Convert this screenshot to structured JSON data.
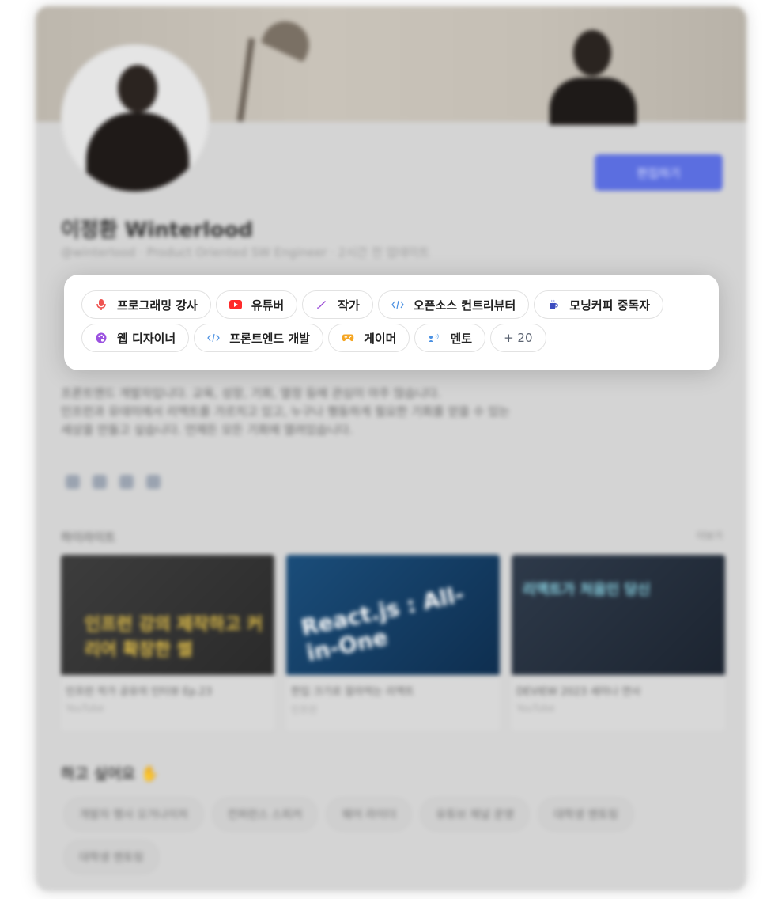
{
  "profile": {
    "name": "이정환 Winterlood",
    "subline": "@winterlood · Product Oriented SW Engineer · 2시간 전 업데이트",
    "edit_button": "편집하기",
    "bio_lines": [
      "프론트엔드 개발자입니다. 교육, 성장, 기회, 열정 등에 관심이 아주 많습니다.",
      "인프런과 유데미에서 리액트를 가르치고 있고, 누구나 행동하게 필요한 기회를 얻을 수 있는",
      "세상을 만들고 싶습니다. 언제든 모든 기회에 열려있습니다."
    ]
  },
  "tags": [
    {
      "label": "프로그래밍 강사",
      "icon": "microphone-icon",
      "color": "#ef5350"
    },
    {
      "label": "유튜버",
      "icon": "youtube-icon",
      "color": "#ff2b2b"
    },
    {
      "label": "작가",
      "icon": "pen-icon",
      "color": "#9c4dd6"
    },
    {
      "label": "오픈소스 컨트리뷰터",
      "icon": "code-icon",
      "color": "#4a90e2"
    },
    {
      "label": "모닝커피 중독자",
      "icon": "coffee-icon",
      "color": "#3b4cc0"
    },
    {
      "label": "웹 디자이너",
      "icon": "palette-icon",
      "color": "#9b51e0"
    },
    {
      "label": "프론트엔드 개발",
      "icon": "code-icon",
      "color": "#4a90e2"
    },
    {
      "label": "게이머",
      "icon": "gamepad-icon",
      "color": "#f5a623"
    },
    {
      "label": "멘토",
      "icon": "mentor-icon",
      "color": "#4a90e2"
    }
  ],
  "more_tag": "+ 20",
  "highlights": {
    "title": "하이라이트",
    "more": "더보기",
    "videos": [
      {
        "title": "인프런 작가 공유의 인터뷰 Ep.23",
        "source": "YouTube",
        "thumb_text": "인프런 강의 제작하고 커리어 확장한 썰"
      },
      {
        "title": "한입 크기로 잘라먹는 리액트",
        "source": "인프런",
        "thumb_text": "React.js : All-in-One"
      },
      {
        "title": "DEVIEW 2023 세미나 연사",
        "source": "YouTube",
        "thumb_text": "리액트가 처음인 당신"
      }
    ]
  },
  "want": {
    "title": "하고 싶어요 ✋",
    "tags": [
      "개발자 행사 오거나이저",
      "컨퍼런스 스피커",
      "웨어 라이더",
      "유튜브 채널 운영",
      "대학생 멘토링",
      "대학생 멘토링"
    ]
  }
}
